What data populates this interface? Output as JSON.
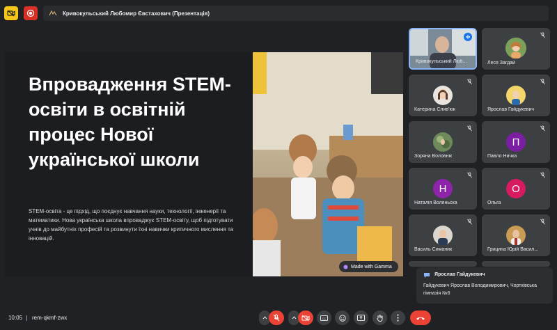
{
  "topbar": {
    "presenter_title": "Кривокульський Любомир Євстахович (Презентація)"
  },
  "slide": {
    "title": "Впровадження STEM-освіти в освітній процес Нової української школи",
    "body": "STEM-освіта - це підхід, що поєднує навчання науки, технології, інженерії та математики. Нова українська школа впроваджує STEM-освіту, щоб підготувати учнів до майбутніх професій та розвинути їхні навички критичного мислення та інновацій.",
    "badge": "Made with Gamma"
  },
  "participants": [
    {
      "name": "Кривокульський Люб...",
      "initial": "",
      "avatar_color": "#5b6a75"
    },
    {
      "name": "Леся Загдай",
      "initial": "",
      "avatar_color": "#c89a6a"
    },
    {
      "name": "Катерина Слив'юк",
      "initial": "",
      "avatar_color": "#b08a70"
    },
    {
      "name": "Ярослав Гайдукевич",
      "initial": "",
      "avatar_color": "#d9b04a"
    },
    {
      "name": "Зоряна Воловнік",
      "initial": "",
      "avatar_color": "#6f8a5a"
    },
    {
      "name": "Павло Ничка",
      "initial": "П",
      "avatar_color": "#7b1fa2"
    },
    {
      "name": "Наталія Воляньска",
      "initial": "Н",
      "avatar_color": "#8e24aa"
    },
    {
      "name": "Ольга",
      "initial": "О",
      "avatar_color": "#d81b60"
    },
    {
      "name": "Василь Симаник",
      "initial": "",
      "avatar_color": "#8a7d70"
    },
    {
      "name": "Грицина Юрій Васил...",
      "initial": "",
      "avatar_color": "#b48a4a"
    }
  ],
  "chat": {
    "sender": "Ярослав Гайдукевич",
    "message": "Гайдукевич Ярослав Володимирович, Чортківська гімназія №6"
  },
  "bottombar": {
    "time": "10:05",
    "meeting_code": "rem-qkmf-zwx"
  },
  "colors": {
    "background": "#202124",
    "tile": "#3c4043",
    "danger": "#ea4335",
    "accent": "#8ab4f8"
  }
}
